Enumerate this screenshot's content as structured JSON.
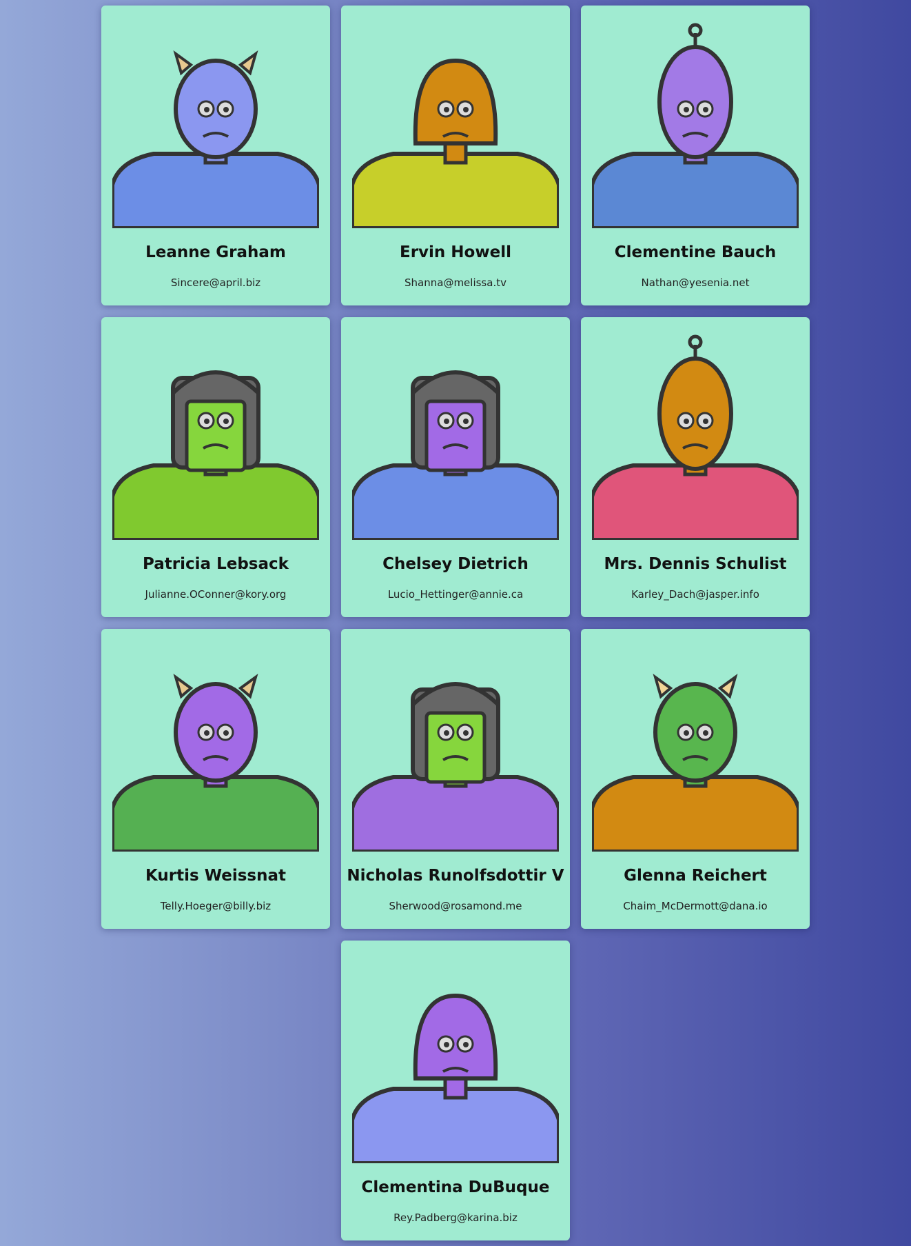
{
  "users": [
    {
      "name": "Leanne Graham",
      "email": "Sincere@april.biz",
      "skin": "#8b97f0",
      "body": "#6c8ee6",
      "accent": "#e7c98f",
      "avatar_icon": "horned-robot-icon"
    },
    {
      "name": "Ervin Howell",
      "email": "Shanna@melissa.tv",
      "skin": "#d28a12",
      "body": "#c7cf2a",
      "accent": "#d28a12",
      "avatar_icon": "hooded-robot-icon"
    },
    {
      "name": "Clementine Bauch",
      "email": "Nathan@yesenia.net",
      "skin": "#a27ae6",
      "body": "#5b88d4",
      "accent": "#777777",
      "avatar_icon": "antenna-robot-icon"
    },
    {
      "name": "Patricia Lebsack",
      "email": "Julianne.OConner@kory.org",
      "skin": "#86d63d",
      "body": "#80c92f",
      "accent": "#666666",
      "avatar_icon": "helmet-robot-icon"
    },
    {
      "name": "Chelsey Dietrich",
      "email": "Lucio_Hettinger@annie.ca",
      "skin": "#a26ae6",
      "body": "#6c8ee6",
      "accent": "#666666",
      "avatar_icon": "helmet-robot-icon"
    },
    {
      "name": "Mrs. Dennis Schulist",
      "email": "Karley_Dach@jasper.info",
      "skin": "#d28a12",
      "body": "#e0557a",
      "accent": "#666666",
      "avatar_icon": "antenna-robot-icon"
    },
    {
      "name": "Kurtis Weissnat",
      "email": "Telly.Hoeger@billy.biz",
      "skin": "#a26ae6",
      "body": "#55b052",
      "accent": "#e7c98f",
      "avatar_icon": "horned-robot-icon"
    },
    {
      "name": "Nicholas Runolfsdottir V",
      "email": "Sherwood@rosamond.me",
      "skin": "#86d63d",
      "body": "#9f6ee0",
      "accent": "#666666",
      "avatar_icon": "helmet-robot-icon"
    },
    {
      "name": "Glenna Reichert",
      "email": "Chaim_McDermott@dana.io",
      "skin": "#58b64e",
      "body": "#d28a12",
      "accent": "#f1d496",
      "avatar_icon": "horned-robot-icon"
    },
    {
      "name": "Clementina DuBuque",
      "email": "Rey.Padberg@karina.biz",
      "skin": "#a26ae6",
      "body": "#8b97f0",
      "accent": "#b9c27a",
      "avatar_icon": "hooded-robot-icon"
    }
  ]
}
